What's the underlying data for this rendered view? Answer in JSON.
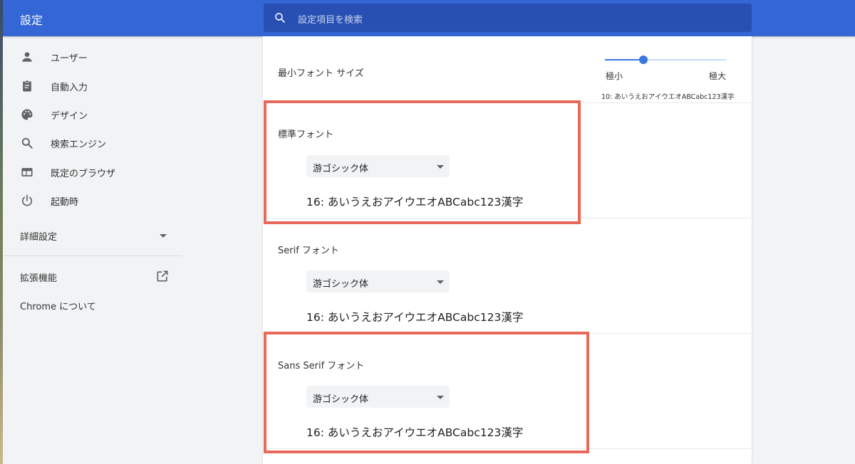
{
  "header": {
    "title": "設定",
    "search_placeholder": "設定項目を検索"
  },
  "sidebar": {
    "items": [
      {
        "label": "ユーザー",
        "icon": "person-icon"
      },
      {
        "label": "自動入力",
        "icon": "clipboard-icon"
      },
      {
        "label": "デザイン",
        "icon": "palette-icon"
      },
      {
        "label": "検索エンジン",
        "icon": "search-icon"
      },
      {
        "label": "既定のブラウザ",
        "icon": "browser-window-icon"
      },
      {
        "label": "起動時",
        "icon": "power-icon"
      }
    ],
    "advanced": "詳細設定",
    "extensions": "拡張機能",
    "about": "Chrome について"
  },
  "content": {
    "min_font": {
      "label": "最小フォント サイズ",
      "slider_min": "極小",
      "slider_max": "極大",
      "slider_level": 0.32,
      "sample": "10: あいうえおアイウエオABCabc123漢字"
    },
    "fonts": [
      {
        "label": "標準フォント",
        "value": "游ゴシック体",
        "sample": "16: あいうえおアイウエオABCabc123漢字"
      },
      {
        "label": "Serif フォント",
        "value": "游ゴシック体",
        "sample": "16: あいうえおアイウエオABCabc123漢字"
      },
      {
        "label": "Sans Serif フォント",
        "value": "游ゴシック体",
        "sample": "16: あいうえおアイウエオABCabc123漢字"
      }
    ]
  },
  "colors": {
    "header": "#3566d6",
    "search": "#2850b3",
    "accent": "#3b77e0",
    "highlight": "#e8685a"
  }
}
